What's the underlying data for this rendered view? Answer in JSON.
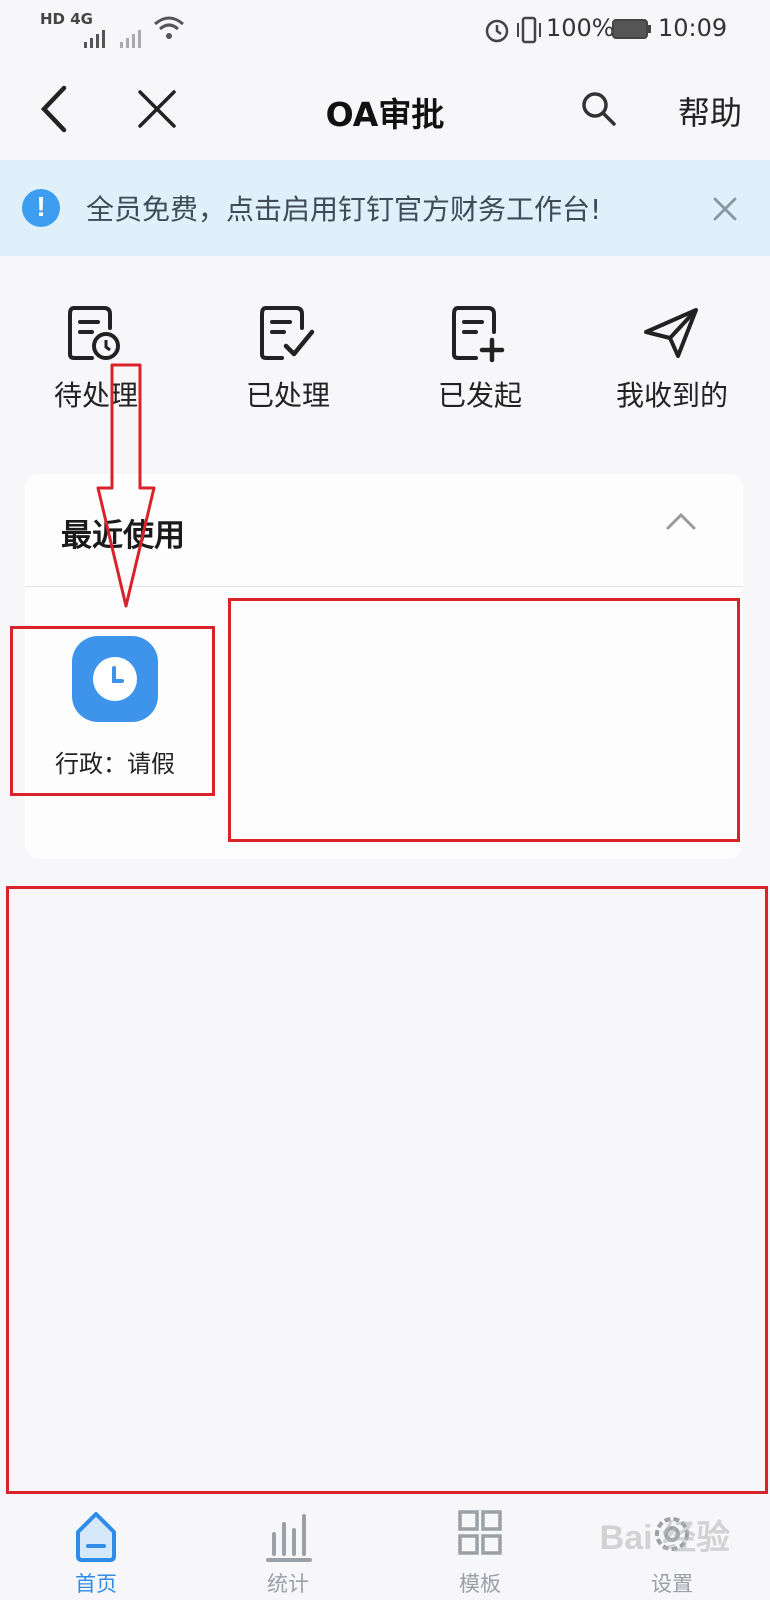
{
  "status_bar": {
    "left_indicators": "HD 4G",
    "battery": "100%",
    "time": "10:09"
  },
  "header": {
    "title": "OA审批",
    "help_label": "帮助",
    "back_icon": "chevron-left-icon",
    "close_icon": "close-icon",
    "search_icon": "search-icon"
  },
  "banner": {
    "text": "全员免费，点击启用钉钉官方财务工作台!",
    "icon": "info-icon",
    "close_icon": "close-icon"
  },
  "quick_actions": [
    {
      "label": "待处理",
      "icon": "pending-doc-icon"
    },
    {
      "label": "已处理",
      "icon": "processed-doc-icon"
    },
    {
      "label": "已发起",
      "icon": "initiated-doc-icon"
    },
    {
      "label": "我收到的",
      "icon": "paper-plane-icon"
    }
  ],
  "recent": {
    "title": "最近使用",
    "collapse_icon": "chevron-up-icon",
    "items": [
      {
        "label": "行政：请假",
        "icon": "clock-icon"
      }
    ]
  },
  "bottom_nav": [
    {
      "label": "首页",
      "icon": "home-icon",
      "active": true
    },
    {
      "label": "统计",
      "icon": "bar-chart-icon",
      "active": false
    },
    {
      "label": "模板",
      "icon": "grid-icon",
      "active": false
    },
    {
      "label": "设置",
      "icon": "gear-icon",
      "active": false
    }
  ],
  "colors": {
    "accent": "#2f8ce8",
    "banner_bg": "#dff0fb",
    "annotation_red": "#d8232a"
  },
  "watermark": "Bai 经验"
}
